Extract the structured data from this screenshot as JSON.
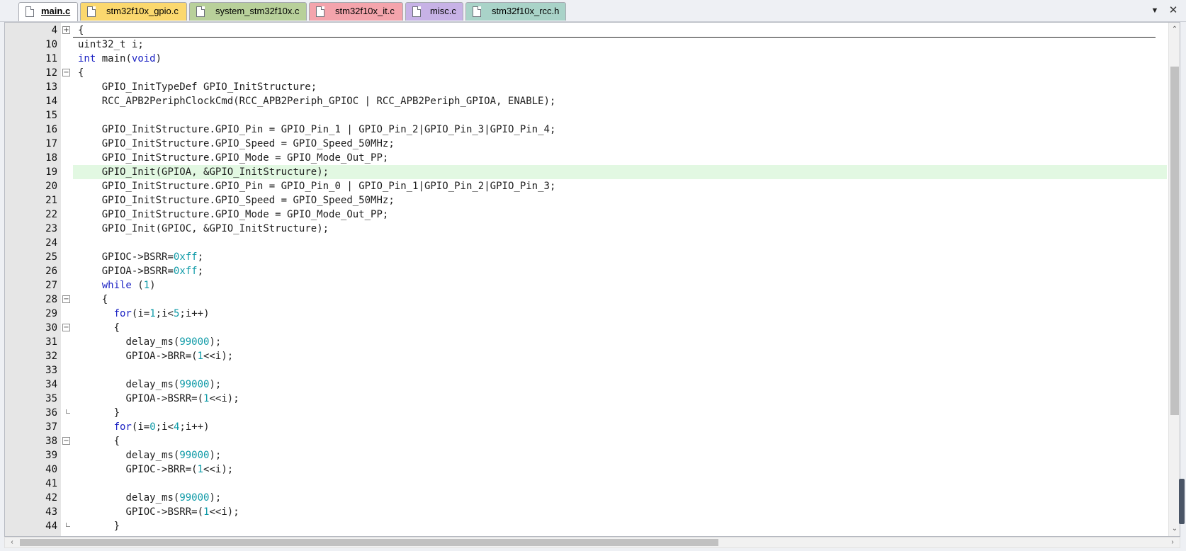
{
  "tabs": [
    {
      "label": "main.c",
      "color": "#ffffff",
      "active": true
    },
    {
      "label": "stm32f10x_gpio.c",
      "color": "#fbd86e",
      "active": false
    },
    {
      "label": "system_stm32f10x.c",
      "color": "#b8d09a",
      "active": false
    },
    {
      "label": "stm32f10x_it.c",
      "color": "#f4a4ac",
      "active": false
    },
    {
      "label": "misc.c",
      "color": "#c7b2e6",
      "active": false
    },
    {
      "label": "stm32f10x_rcc.h",
      "color": "#a9d3c8",
      "active": false
    }
  ],
  "toolbar": {
    "dropdown_icon": "chevron-down-icon",
    "close_icon": "close-icon",
    "dropdown_glyph": "▼",
    "close_glyph": "✕"
  },
  "editor": {
    "current_line": 19,
    "lines": [
      {
        "n": "4",
        "fold": "plus",
        "code": "{"
      },
      {
        "n": "10",
        "fold": "",
        "code": "uint32_t i;"
      },
      {
        "n": "11",
        "fold": "",
        "code": "int main(void)"
      },
      {
        "n": "12",
        "fold": "minus",
        "code": "{"
      },
      {
        "n": "13",
        "fold": "",
        "code": "    GPIO_InitTypeDef GPIO_InitStructure;"
      },
      {
        "n": "14",
        "fold": "",
        "code": "    RCC_APB2PeriphClockCmd(RCC_APB2Periph_GPIOC | RCC_APB2Periph_GPIOA, ENABLE);"
      },
      {
        "n": "15",
        "fold": "",
        "code": ""
      },
      {
        "n": "16",
        "fold": "",
        "code": "    GPIO_InitStructure.GPIO_Pin = GPIO_Pin_1 | GPIO_Pin_2|GPIO_Pin_3|GPIO_Pin_4;"
      },
      {
        "n": "17",
        "fold": "",
        "code": "    GPIO_InitStructure.GPIO_Speed = GPIO_Speed_50MHz;"
      },
      {
        "n": "18",
        "fold": "",
        "code": "    GPIO_InitStructure.GPIO_Mode = GPIO_Mode_Out_PP;"
      },
      {
        "n": "19",
        "fold": "",
        "code": "    GPIO_Init(GPIOA, &GPIO_InitStructure);"
      },
      {
        "n": "20",
        "fold": "",
        "code": "    GPIO_InitStructure.GPIO_Pin = GPIO_Pin_0 | GPIO_Pin_1|GPIO_Pin_2|GPIO_Pin_3;"
      },
      {
        "n": "21",
        "fold": "",
        "code": "    GPIO_InitStructure.GPIO_Speed = GPIO_Speed_50MHz;"
      },
      {
        "n": "22",
        "fold": "",
        "code": "    GPIO_InitStructure.GPIO_Mode = GPIO_Mode_Out_PP;"
      },
      {
        "n": "23",
        "fold": "",
        "code": "    GPIO_Init(GPIOC, &GPIO_InitStructure);"
      },
      {
        "n": "24",
        "fold": "",
        "code": ""
      },
      {
        "n": "25",
        "fold": "",
        "code": "    GPIOC->BSRR=0xff;"
      },
      {
        "n": "26",
        "fold": "",
        "code": "    GPIOA->BSRR=0xff;"
      },
      {
        "n": "27",
        "fold": "",
        "code": "    while (1)"
      },
      {
        "n": "28",
        "fold": "minus",
        "code": "    {"
      },
      {
        "n": "29",
        "fold": "",
        "code": "      for(i=1;i<5;i++)"
      },
      {
        "n": "30",
        "fold": "minus",
        "code": "      {"
      },
      {
        "n": "31",
        "fold": "",
        "code": "        delay_ms(99000);"
      },
      {
        "n": "32",
        "fold": "",
        "code": "        GPIOA->BRR=(1<<i);"
      },
      {
        "n": "33",
        "fold": "",
        "code": ""
      },
      {
        "n": "34",
        "fold": "",
        "code": "        delay_ms(99000);"
      },
      {
        "n": "35",
        "fold": "",
        "code": "        GPIOA->BSRR=(1<<i);"
      },
      {
        "n": "36",
        "fold": "end",
        "code": "      }"
      },
      {
        "n": "37",
        "fold": "",
        "code": "      for(i=0;i<4;i++)"
      },
      {
        "n": "38",
        "fold": "minus",
        "code": "      {"
      },
      {
        "n": "39",
        "fold": "",
        "code": "        delay_ms(99000);"
      },
      {
        "n": "40",
        "fold": "",
        "code": "        GPIOC->BRR=(1<<i);"
      },
      {
        "n": "41",
        "fold": "",
        "code": ""
      },
      {
        "n": "42",
        "fold": "",
        "code": "        delay_ms(99000);"
      },
      {
        "n": "43",
        "fold": "",
        "code": "        GPIOC->BSRR=(1<<i);"
      },
      {
        "n": "44",
        "fold": "end",
        "code": "      }"
      }
    ]
  },
  "scrollbars": {
    "vertical": {
      "up_glyph": "⌃",
      "down_glyph": "⌄"
    },
    "horizontal": {
      "left_glyph": "‹",
      "right_glyph": "›"
    }
  },
  "syntax": {
    "keywords": [
      "int",
      "void",
      "while",
      "for"
    ]
  }
}
